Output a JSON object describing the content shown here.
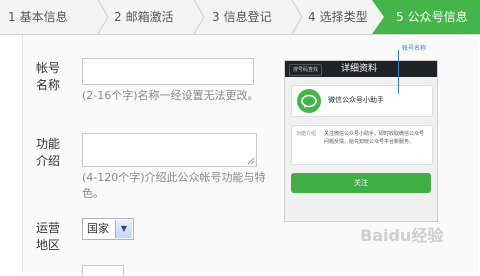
{
  "steps": [
    {
      "num": "1",
      "label": "基本信息"
    },
    {
      "num": "2",
      "label": "邮箱激活"
    },
    {
      "num": "3",
      "label": "信息登记"
    },
    {
      "num": "4",
      "label": "选择类型"
    }
  ],
  "active_step": {
    "num": "5",
    "label": "公众号信息"
  },
  "form": {
    "account_name_label": "帐号\n名称",
    "account_name_value": "",
    "account_name_hint": "(2-16个字)名称一经设置无法更改。",
    "intro_label": "功能\n介绍",
    "intro_value": "",
    "intro_hint": "(4-120个字)介绍此公众帐号功能与特色。",
    "region_label": "运营\n地区",
    "region_value": "国家"
  },
  "preview": {
    "back_label": "搜号码查找",
    "title": "详细资料",
    "account_name": "微信公众号小助手",
    "intro_label": "功能介绍",
    "intro_text": "关注微信公众号小助手，即时收取微信公众号问题反馈，给先知晓公众号平台新服务。",
    "follow_label": "关注",
    "callout": "帐号名称"
  },
  "watermark": "Baidu经验",
  "colors": {
    "accent": "#44b549",
    "callout": "#2f7fd3"
  }
}
